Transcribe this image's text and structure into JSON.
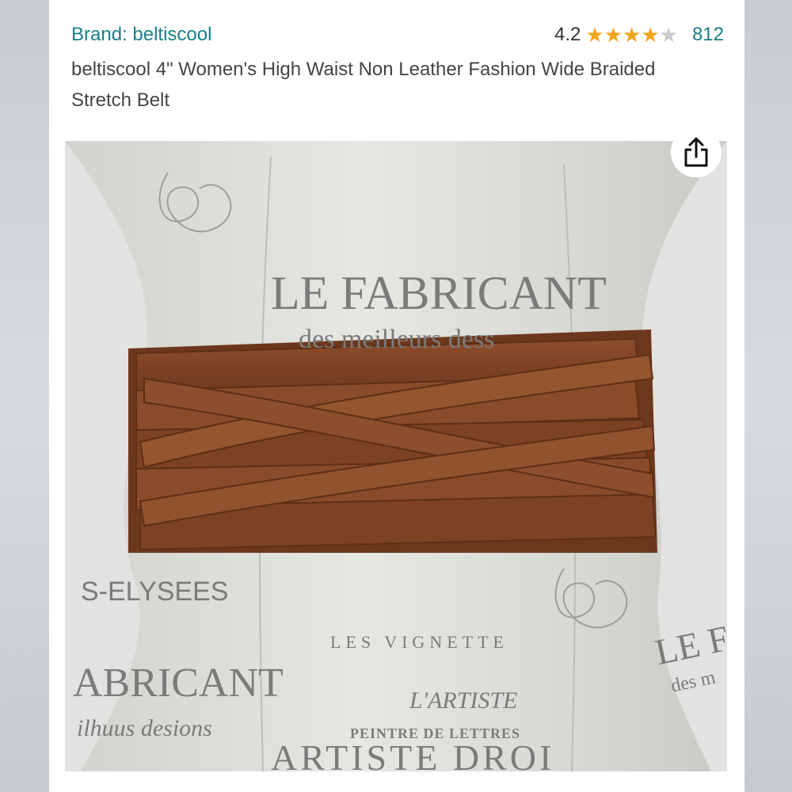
{
  "product": {
    "brand_link": "Brand: beltiscool",
    "rating_value": "4.2",
    "rating_stars": 4.2,
    "review_count": "812",
    "title": "beltiscool 4\" Women's High Waist Non Leather Fashion Wide Braided Stretch Belt"
  },
  "image": {
    "alt": "Brown braided wide belt on a printed dress form",
    "printed_text": {
      "le_fabricant": "LE FABRICANT",
      "des_meilleurs": "des meilleurs dess",
      "elysees": "S-ELYSEES",
      "fabricant_lower": "ABRICANT",
      "meilleurs_lower": "ilhuus desions",
      "vignette": "LES VIGNETTE",
      "lartiste": "L'ARTISTE",
      "peintre": "PEINTRE DE LETTRES",
      "artiste_droi": "ARTISTE DROI",
      "le_right": "LE F",
      "des_right": "des m"
    }
  },
  "share": {
    "icon": "share-icon"
  },
  "colors": {
    "link": "#1a7f86",
    "star": "#f2a41a",
    "belt": "#8b4a2b"
  }
}
